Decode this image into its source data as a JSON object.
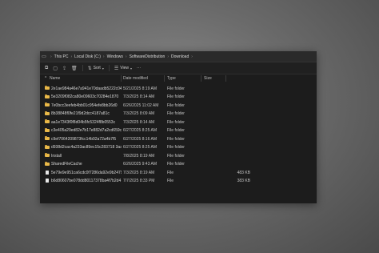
{
  "address": {
    "crumbs": [
      "This PC",
      "Local Disk (C:)",
      "Windows",
      "SoftwareDistribution",
      "Download"
    ]
  },
  "toolbar": {
    "new_icon": "plus-icon",
    "sort_label": "Sort",
    "view_label": "View",
    "more_label": "···"
  },
  "columns": {
    "name": "Name",
    "date": "Date modified",
    "type": "Type",
    "size": "Size"
  },
  "files": [
    {
      "name": "2e1ae984a46e7a941e70daadb5222c04",
      "date": "5/21/2025 8:19 AM",
      "type": "File folder",
      "size": "",
      "kind": "folder"
    },
    {
      "name": "5e3209f082ca80e09603c70284e1870",
      "date": "7/3/2025 8:14 AM",
      "type": "File folder",
      "size": "",
      "kind": "folder"
    },
    {
      "name": "7e0bcc3eefeb4bb01c954efe8bb26d0",
      "date": "6/26/2025 11:02 AM",
      "type": "File folder",
      "size": "",
      "kind": "folder"
    },
    {
      "name": "8b38848f0fe21f9d2dcc4187a81c",
      "date": "7/3/2025 8:09 AM",
      "type": "File folder",
      "size": "",
      "kind": "folder"
    },
    {
      "name": "aa1e7343f0f8d04b5fc5324f8b0553c",
      "date": "7/3/2025 8:14 AM",
      "type": "File folder",
      "size": "",
      "kind": "folder"
    },
    {
      "name": "c3e405a29ed82e7b17e882d7a2cd659c",
      "date": "6/27/2025 8:25 AM",
      "type": "File folder",
      "size": "",
      "kind": "folder"
    },
    {
      "name": "c9ef7064209873fcc14b92a72a4b7f5",
      "date": "6/27/2025 8:16 AM",
      "type": "File folder",
      "size": "",
      "kind": "folder"
    },
    {
      "name": "d938d2cac4a233ac89ec15c283718 3aa",
      "date": "6/27/2025 8:25 AM",
      "type": "File folder",
      "size": "",
      "kind": "folder"
    },
    {
      "name": "Install",
      "date": "7/8/2025 8:19 AM",
      "type": "File folder",
      "size": "",
      "kind": "folder"
    },
    {
      "name": "SharedFileCache",
      "date": "6/26/2025 9:43 AM",
      "type": "File folder",
      "size": "",
      "kind": "folder"
    },
    {
      "name": "5e79e9e951ca6cdc0f7286da92e9b2479aaa",
      "date": "7/3/2025 8:19 AM",
      "type": "File",
      "size": "483 KB",
      "kind": "file"
    },
    {
      "name": "b6d80607be078dd80117378ba4f7b2d4",
      "date": "7/7/2025 8:33 PM",
      "type": "File",
      "size": "383 KB",
      "kind": "file"
    }
  ]
}
